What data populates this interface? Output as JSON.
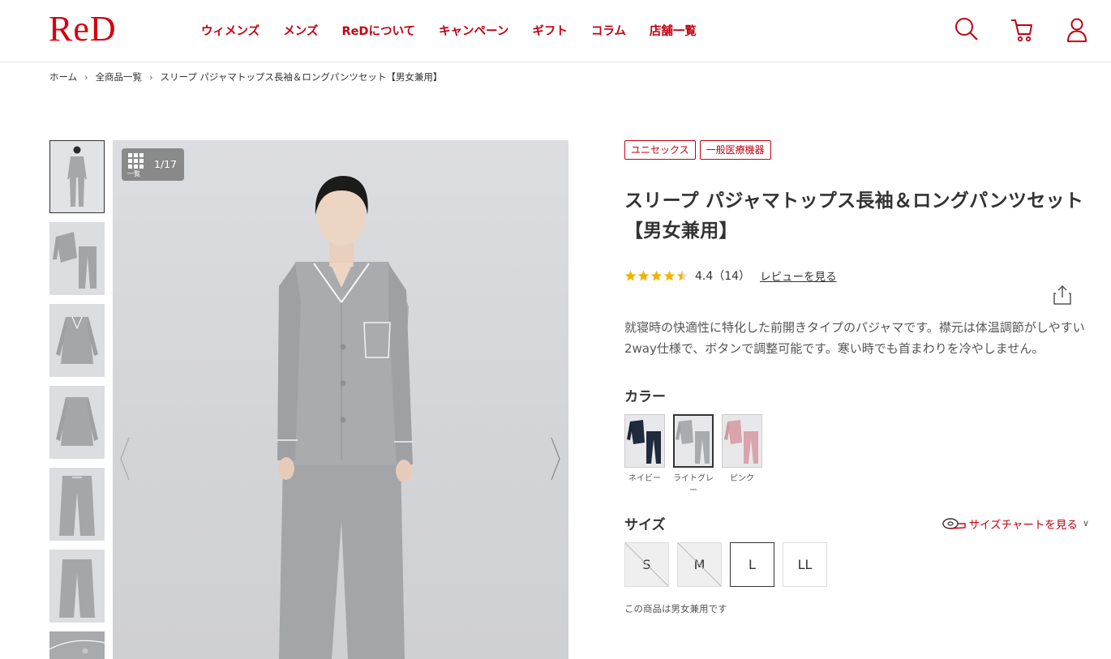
{
  "header": {
    "logo": "ReD",
    "nav": [
      "ウィメンズ",
      "メンズ",
      "ReDについて",
      "キャンペーン",
      "ギフト",
      "コラム",
      "店舗一覧"
    ]
  },
  "breadcrumb": {
    "items": [
      "ホーム",
      "全商品一覧",
      "スリープ パジャマトップス長袖＆ロングパンツセット【男女兼用】"
    ],
    "separator": "›"
  },
  "gallery": {
    "grid_label": "一覧",
    "counter": "1/17"
  },
  "product": {
    "tags": [
      "ユニセックス",
      "一般医療機器"
    ],
    "title_line1": "スリープ パジャマトップス長袖＆ロングパンツセット",
    "title_line2": "【男女兼用】",
    "rating": 4.4,
    "rating_text": "4.4（14）",
    "review_link": "レビューを見る",
    "description": "就寝時の快適性に特化した前開きタイプのパジャマです。襟元は体温調節がしやすい2way仕様で、ボタンで調整可能です。寒い時でも首まわりを冷やしません。",
    "color_label": "カラー",
    "colors": [
      {
        "name": "ネイビー",
        "hex": "#1f2a3c"
      },
      {
        "name": "ライトグレー",
        "hex": "#a9abae"
      },
      {
        "name": "ピンク",
        "hex": "#d9a4ad"
      }
    ],
    "selected_color": "ライトグレー",
    "size_label": "サイズ",
    "size_chart_link": "サイズチャートを見る",
    "sizes": [
      {
        "label": "S",
        "available": false
      },
      {
        "label": "M",
        "available": false
      },
      {
        "label": "L",
        "available": true,
        "selected": true
      },
      {
        "label": "LL",
        "available": true
      }
    ],
    "note": "この商品は男女兼用です"
  },
  "colors": {
    "brand": "#d7000f",
    "nav": "#c40012",
    "star": "#f0b400"
  }
}
